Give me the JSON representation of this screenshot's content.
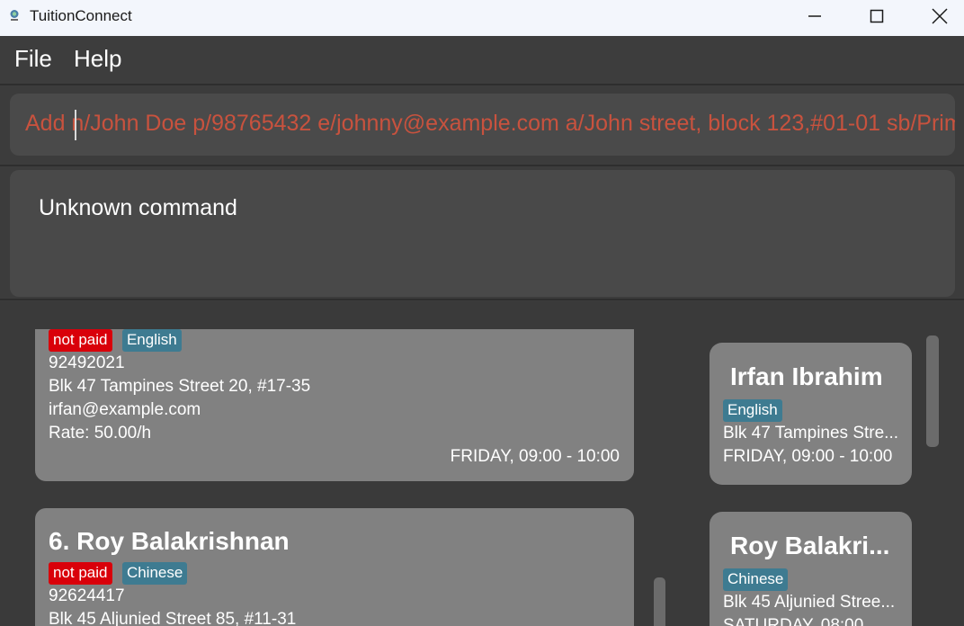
{
  "window": {
    "title": "TuitionConnect"
  },
  "menu": {
    "file": "File",
    "help": "Help"
  },
  "command": {
    "value": "Add n/John Doe p/98765432 e/johnny@example.com a/John street, block 123,#01-01 sb/Prim"
  },
  "result": {
    "message": "Unknown command"
  },
  "tutee_list": [
    {
      "payment_tag": "not paid",
      "subject_tag": "English",
      "phone": "92492021",
      "address": "Blk 47 Tampines Street 20, #17-35",
      "email": "irfan@example.com",
      "rate": "Rate: 50.00/h",
      "schedule": "FRIDAY, 09:00 - 10:00"
    },
    {
      "index_name": "6.  Roy Balakrishnan",
      "payment_tag": "not paid",
      "subject_tag": "Chinese",
      "phone": "92624417",
      "address": "Blk 45 Aljunied Street 85, #11-31"
    }
  ],
  "schedule_list": [
    {
      "name": "Irfan Ibrahim",
      "subject_tag": "English",
      "address": "Blk 47 Tampines Stre...",
      "schedule": "FRIDAY, 09:00 - 10:00"
    },
    {
      "name": "Roy Balakri...",
      "subject_tag": "Chinese",
      "address": "Blk 45 Aljunied Stree...",
      "schedule": "SATURDAY, 08:00"
    }
  ],
  "colors": {
    "command_text": "#c8523e",
    "not_paid_tag": "#d9000a",
    "subject_tag": "#3e7b91",
    "card": "#818181"
  },
  "icons": [
    "app-icon",
    "minimize-icon",
    "maximize-icon",
    "close-icon"
  ]
}
